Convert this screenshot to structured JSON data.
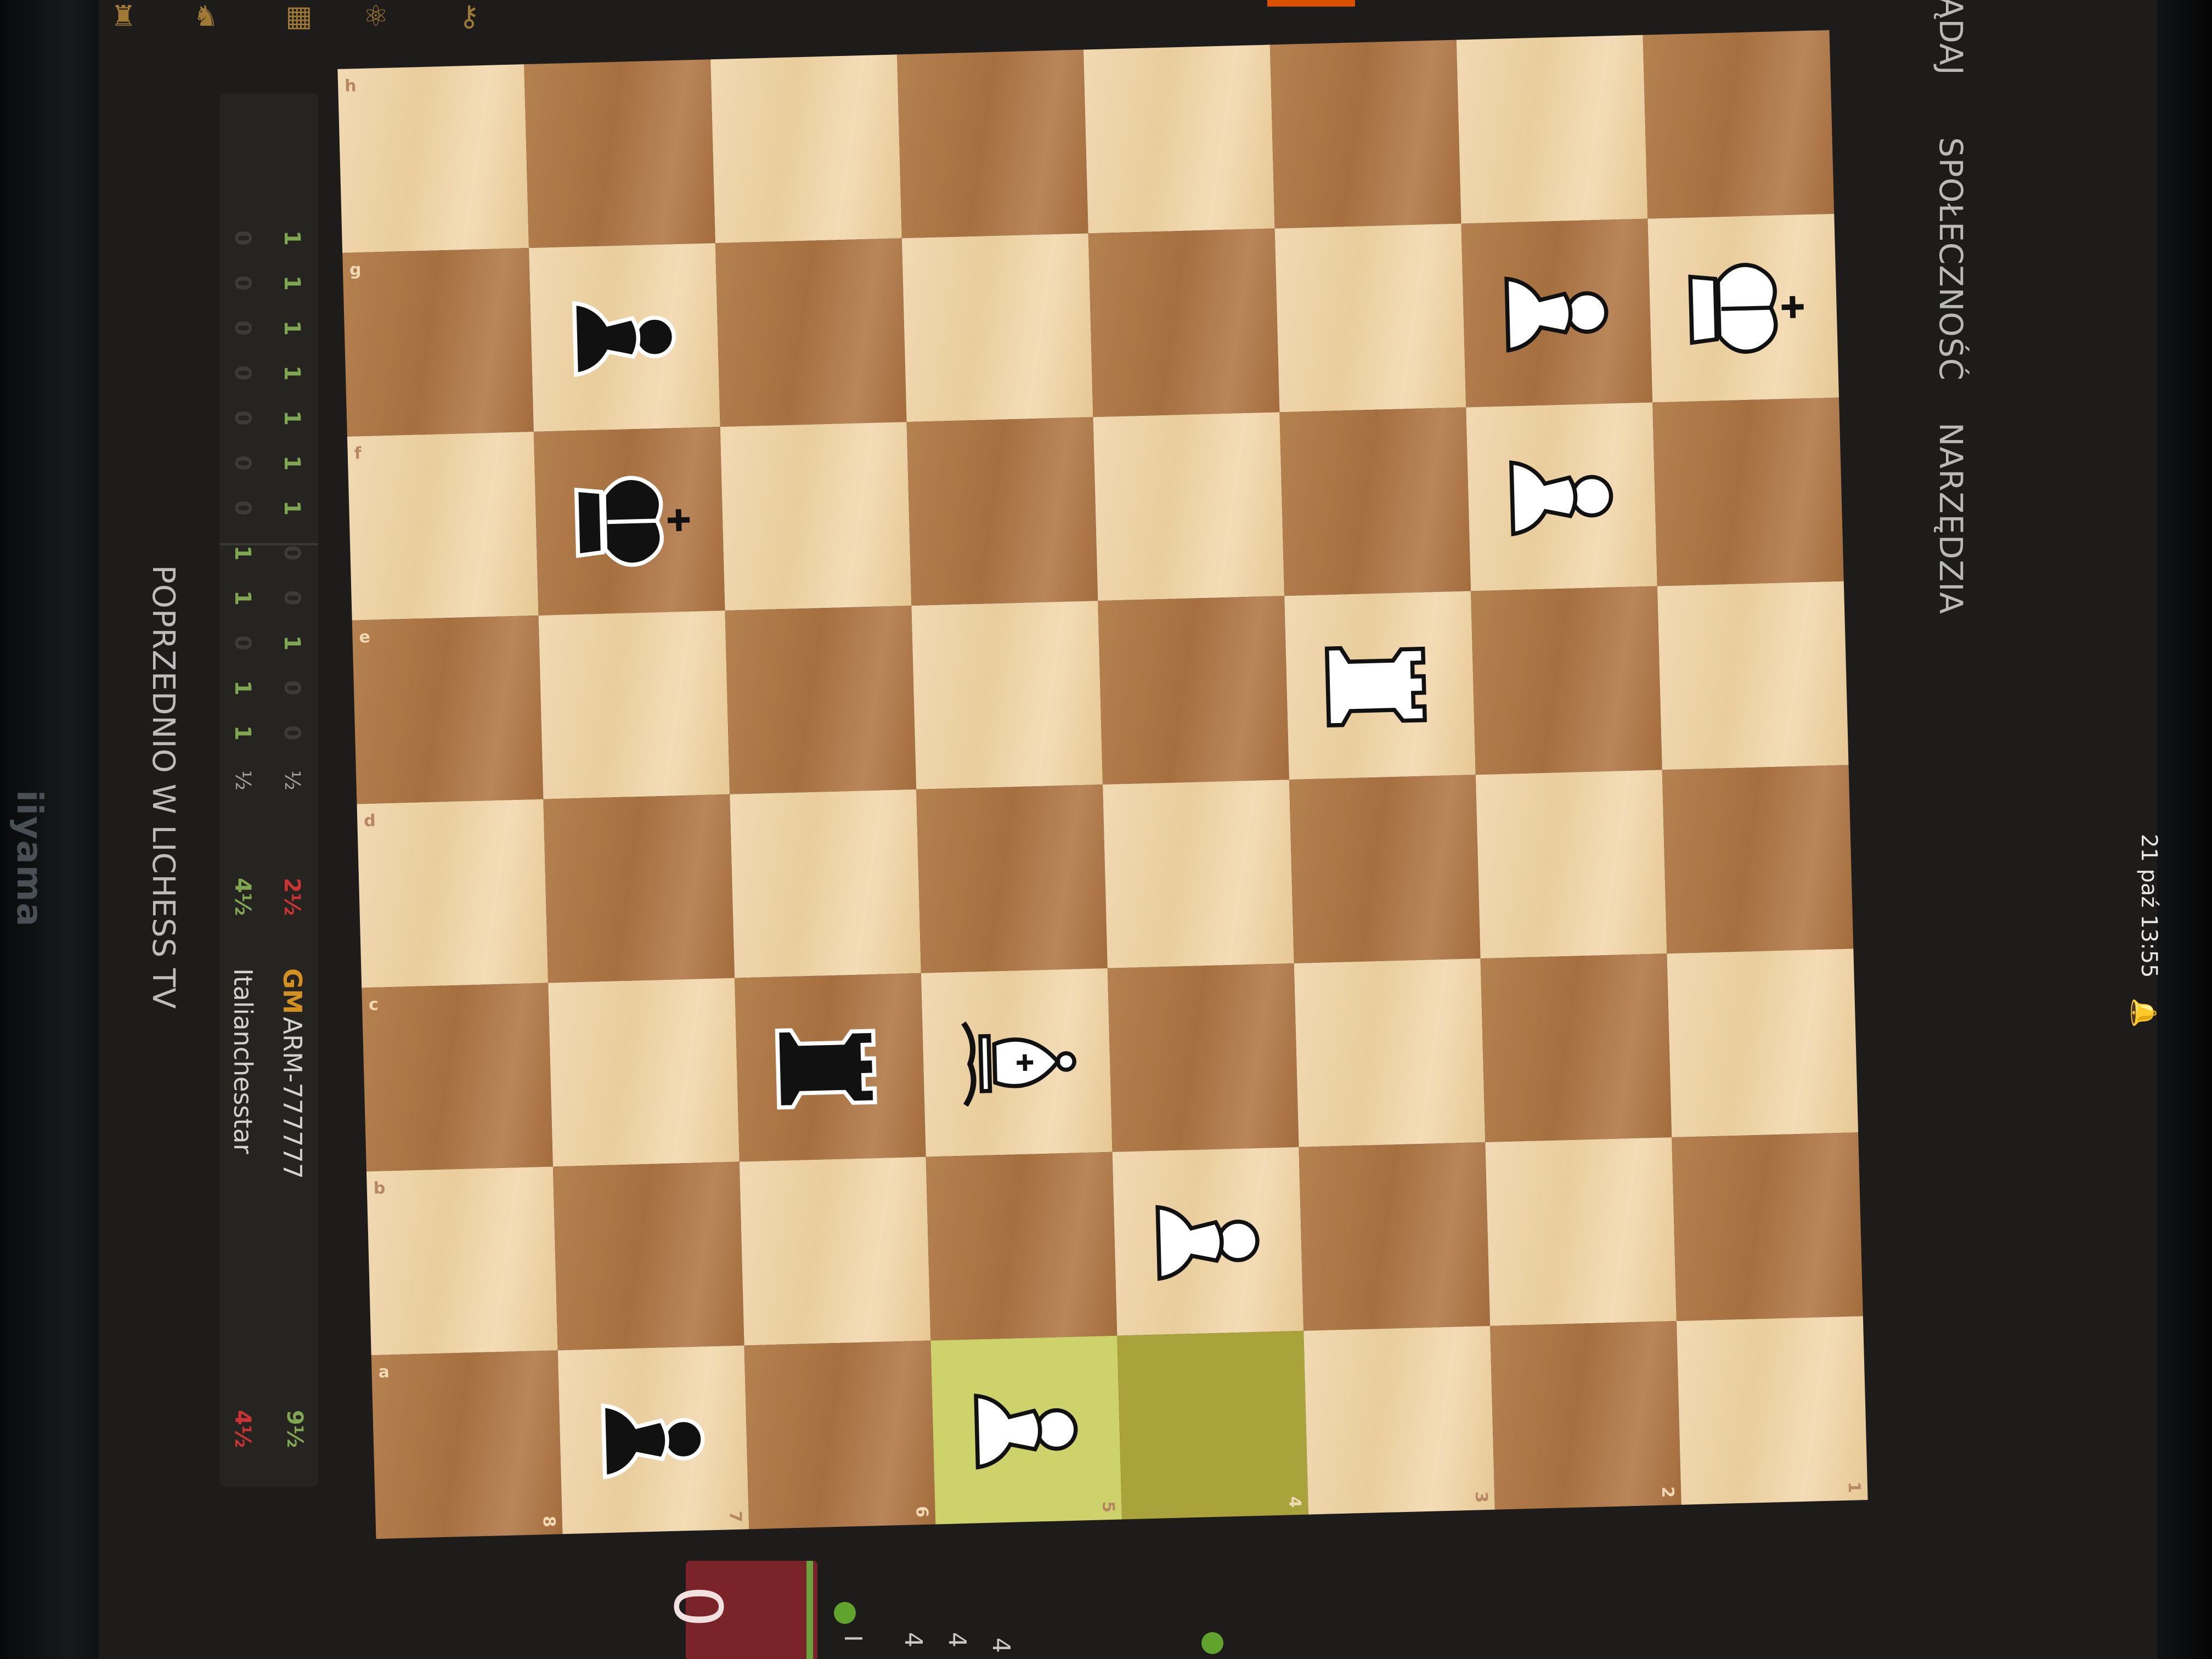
{
  "nav": {
    "watch": "ŁĄDAJ",
    "community": "SPOŁECZNOŚĆ",
    "tools": "NARZĘDZIA"
  },
  "system": {
    "clock": "21 paź 13:55"
  },
  "monitor": {
    "brand": "iiyama"
  },
  "crosstable": {
    "player1": {
      "title": "GM",
      "name": "ARM-777777",
      "total": "9½",
      "recent": "2½"
    },
    "player2": {
      "name": "Italianchesstar",
      "total": "4½",
      "recent": "4½"
    },
    "row1": [
      "1",
      "1",
      "1",
      "1",
      "1",
      "1",
      "1",
      "0",
      "0",
      "1",
      "0",
      "0",
      "½"
    ],
    "row2": [
      "0",
      "0",
      "0",
      "0",
      "0",
      "0",
      "0",
      "1",
      "1",
      "0",
      "1",
      "1",
      "½"
    ]
  },
  "previously_tv": "POPRZEDNIO W LICHESS TV",
  "board": {
    "files": [
      "h",
      "g",
      "f",
      "e",
      "d",
      "c",
      "b",
      "a"
    ],
    "ranks": [
      "8",
      "7",
      "6",
      "5",
      "4",
      "3",
      "2",
      "1"
    ],
    "pieces": [
      {
        "square": "g7",
        "piece": "black-pawn"
      },
      {
        "square": "f7",
        "piece": "black-king"
      },
      {
        "square": "c6",
        "piece": "black-rook"
      },
      {
        "square": "c5",
        "piece": "white-bishop"
      },
      {
        "square": "b4",
        "piece": "white-pawn"
      },
      {
        "square": "a7",
        "piece": "black-pawn"
      },
      {
        "square": "a5",
        "piece": "white-pawn"
      },
      {
        "square": "e3",
        "piece": "white-rook"
      },
      {
        "square": "g2",
        "piece": "white-pawn"
      },
      {
        "square": "f2",
        "piece": "white-pawn"
      },
      {
        "square": "g1",
        "piece": "white-king"
      }
    ],
    "last_move": [
      "a5",
      "a4"
    ]
  },
  "mini_board": {
    "clock": "0",
    "lines": [
      "I",
      "4",
      "4",
      "4"
    ]
  }
}
